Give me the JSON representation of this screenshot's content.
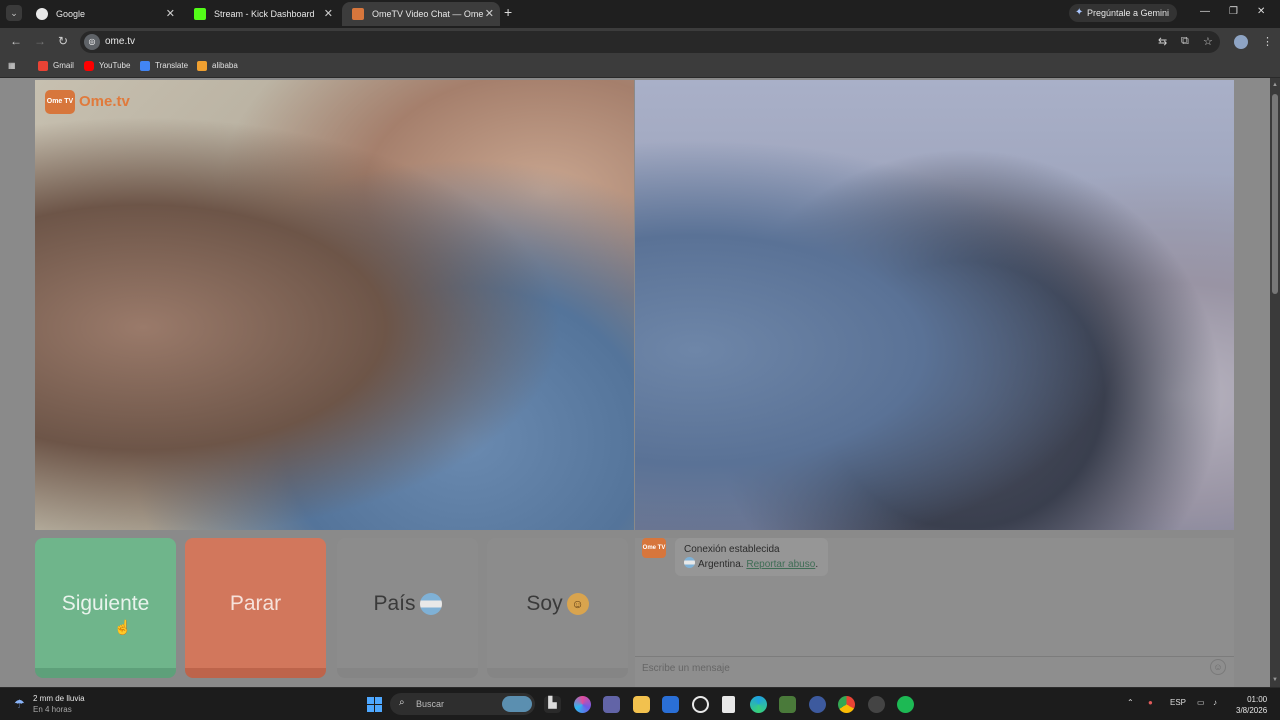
{
  "browser": {
    "tabs": [
      {
        "title": "Google",
        "active": false,
        "icon": "google-icon"
      },
      {
        "title": "Stream - Kick Dashboard",
        "active": false,
        "icon": "kick-icon"
      },
      {
        "title": "OmeTV Video Chat — Ome",
        "active": true,
        "icon": "ometv-icon"
      }
    ],
    "gemini_label": "Pregúntale a Gemini",
    "url": "ome.tv",
    "bookmarks": [
      "Gmail",
      "YouTube",
      "Translate",
      "alibaba"
    ]
  },
  "page": {
    "logo_text": "Ome.tv",
    "logo_badge": "Ome TV",
    "buttons": {
      "next": "Siguiente",
      "stop": "Parar",
      "country": "País",
      "iam": "Soy"
    },
    "chat": {
      "status_line": "Conexión establecida",
      "country": "Argentina.",
      "report_link": "Reportar abuso",
      "report_suffix": ".",
      "message_placeholder": "Escribe un mensaje"
    }
  },
  "taskbar": {
    "weather_line1": "2 mm de lluvia",
    "weather_line2": "En 4 horas",
    "search_placeholder": "Buscar",
    "language": "ESP",
    "time": "01:00",
    "date": "3/8/2026"
  },
  "colors": {
    "next_button": "#6fb58b",
    "stop_button": "#d2775c",
    "brand_orange": "#d7763c",
    "report_link": "#3f6d55"
  }
}
